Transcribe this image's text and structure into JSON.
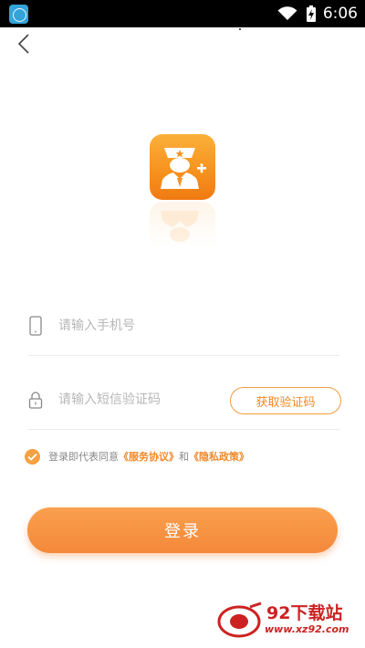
{
  "status_bar": {
    "time": "6:06",
    "icons": [
      "app-notification-icon",
      "wifi-icon",
      "battery-charging-icon"
    ]
  },
  "nav": {
    "back_icon": "chevron-left-icon"
  },
  "logo": {
    "icon": "officer-avatar-plus-icon",
    "colors": {
      "top": "#fbb03b",
      "bottom": "#f07a12"
    }
  },
  "form": {
    "phone": {
      "icon": "phone-icon",
      "placeholder": "请输入手机号",
      "value": ""
    },
    "code": {
      "icon": "lock-icon",
      "placeholder": "请输入短信验证码",
      "value": ""
    },
    "get_code_label": "获取验证码"
  },
  "agreement": {
    "checked": true,
    "prefix": "登录即代表同意",
    "service_link": "《服务协议》",
    "conjunction": "和",
    "privacy_link": "《隐私政策》"
  },
  "login_label": "登录",
  "watermark": {
    "title": "92下载站",
    "url": "www.xz92.com"
  },
  "colors": {
    "accent": "#f4883a",
    "link": "#f0882a",
    "placeholder": "#b7b7b7"
  }
}
